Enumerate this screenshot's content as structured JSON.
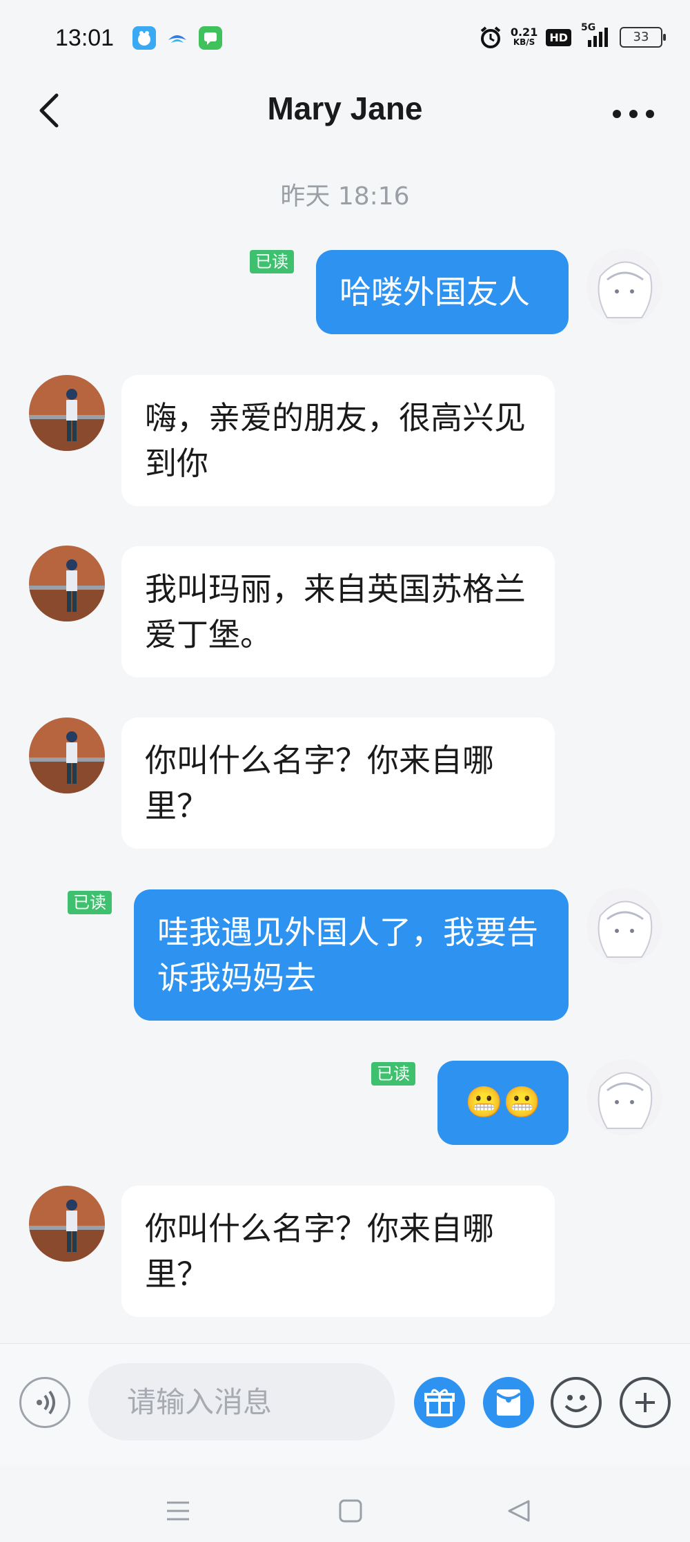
{
  "status_bar": {
    "time": "13:01",
    "net_speed_value": "0.21",
    "net_speed_unit": "KB/S",
    "hd_label": "HD",
    "signal_label": "5G",
    "battery": "33"
  },
  "header": {
    "title": "Mary Jane",
    "back_icon": "chevron-left-icon",
    "more_icon": "more-dots-icon"
  },
  "timestamp": "昨天 18:16",
  "read_label": "已读",
  "messages": [
    {
      "side": "out",
      "text": "哈喽外国友人",
      "read": true
    },
    {
      "side": "in",
      "text": "嗨，亲爱的朋友，很高兴见到你"
    },
    {
      "side": "in",
      "text": "我叫玛丽，来自英国苏格兰爱丁堡。"
    },
    {
      "side": "in",
      "text": "你叫什么名字？你来自哪里？"
    },
    {
      "side": "out",
      "text": "哇我遇见外国人了，我要告诉我妈妈去",
      "read": true
    },
    {
      "side": "out",
      "text": "😬😬",
      "read": true
    },
    {
      "side": "in",
      "text": "你叫什么名字？你来自哪里？"
    }
  ],
  "input_bar": {
    "placeholder": "请输入消息",
    "voice_icon": "voice-icon",
    "gift_icon": "gift-icon",
    "red_packet_icon": "red-packet-icon",
    "emoji_icon": "emoji-icon",
    "plus_icon": "plus-icon"
  },
  "colors": {
    "outgoing_bubble": "#2e93f0",
    "incoming_bubble": "#ffffff",
    "read_badge": "#3ec06e",
    "background": "#f4f6f8"
  }
}
